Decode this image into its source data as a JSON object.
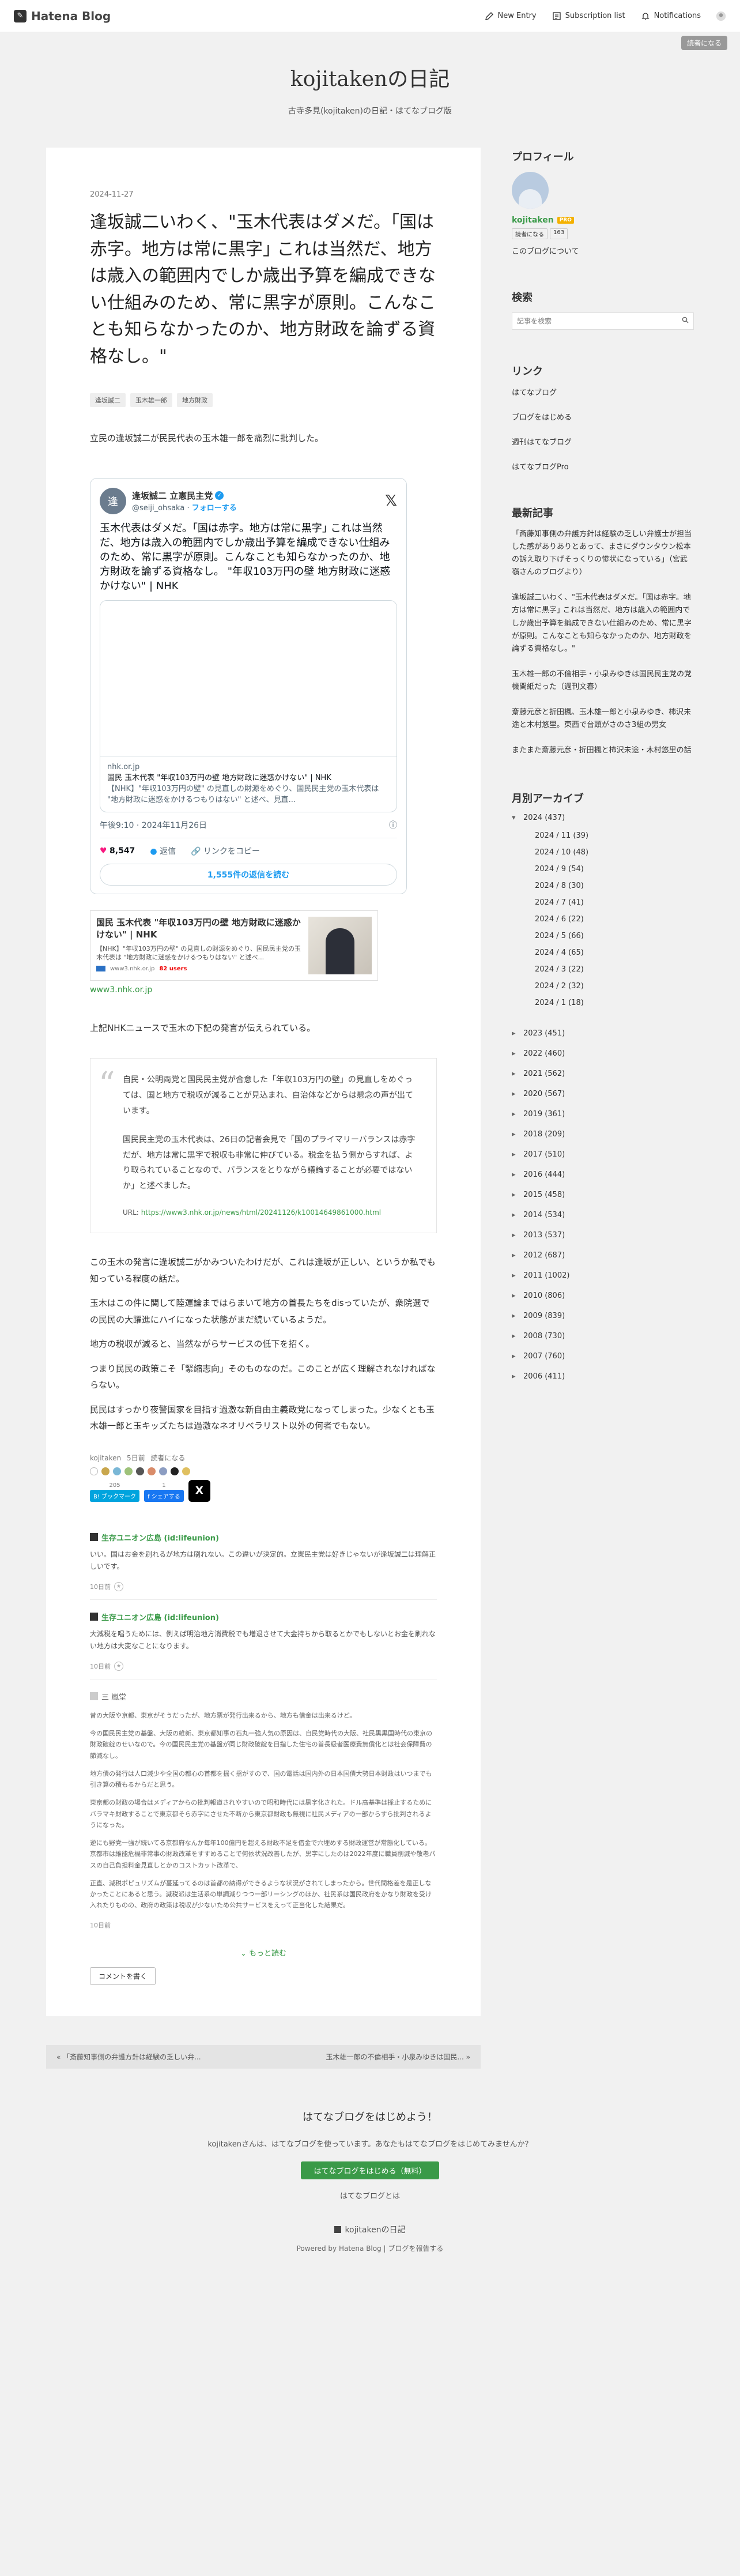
{
  "global_header": {
    "logo": "Hatena Blog",
    "new_entry": "New Entry",
    "subscription": "Subscription list",
    "notifications": "Notifications",
    "reader": "読者になる"
  },
  "blog": {
    "title": "kojitakenの日記",
    "description": "古寺多見(kojitaken)の日記・はてなブログ版"
  },
  "article": {
    "date": "2024-11-27",
    "title": "逢坂誠二いわく、\"玉木代表はダメだ。｢国は赤字。地方は常に黒字｣ これは当然だ、地方は歳入の範囲内でしか歳出予算を編成できない仕組みのため、常に黒字が原則。こんなことも知らなかったのか、地方財政を論ずる資格なし。\"",
    "categories": [
      "逢坂誠二",
      "玉木雄一郎",
      "地方財政"
    ],
    "intro": "立民の逢坂誠二が民民代表の玉木雄一郎を痛烈に批判した。",
    "tweet": {
      "avatar": "逢",
      "name": "逢坂誠二 立憲民主党",
      "handle": "@seiji_ohsaka",
      "follow": "フォローする",
      "text": "玉木代表はダメだ。｢国は赤字。地方は常に黒字｣ これは当然だ、地方は歳入の範囲内でしか歳出予算を編成できない仕組みのため、常に黒字が原則。こんなことも知らなかったのか、地方財政を論ずる資格なし。 \"年収103万円の壁 地方財政に迷惑かけない\" | NHK",
      "card_domain": "nhk.or.jp",
      "card_title": "国民 玉木代表 \"年収103万円の壁 地方財政に迷惑かけない\" | NHK",
      "card_desc": "【NHK】\"年収103万円の壁\" の見直しの財源をめぐり、国民民主党の玉木代表は \"地方財政に迷惑をかけるつもりはない\" と述べ、見直...",
      "time": "午後9:10 · 2024年11月26日",
      "likes": "8,547",
      "reply": "返信",
      "copy": "リンクをコピー",
      "read_replies": "1,555件の返信を読む"
    },
    "embed": {
      "title": "国民 玉木代表 \"年収103万円の壁 地方財政に迷惑かけない\" | NHK",
      "desc": "【NHK】\"年収103万円の壁\" の見直しの財源をめぐり、国民民主党の玉木代表は \"地方財政に迷惑をかけるつもりはない\" と述べ...",
      "source": "www3.nhk.or.jp",
      "users": "82 users",
      "url": "www3.nhk.or.jp"
    },
    "p_after_embed": "上記NHKニュースで玉木の下記の発言が伝えられている。",
    "quote_p1": "自民・公明両党と国民民主党が合意した「年収103万円の壁」の見直しをめぐっては、国と地方で税収が減ることが見込まれ、自治体などからは懸念の声が出ています。",
    "quote_p2": "国民民主党の玉木代表は、26日の記者会見で「国のプライマリーバランスは赤字だが、地方は常に黒字で税収も非常に伸びている。税金を払う側からすれば、より取られていることなので、バランスをとりながら議論することが必要ではないか」と述べました。",
    "quote_url_label": "URL:",
    "quote_url": "https://www3.nhk.or.jp/news/html/20241126/k10014649861000.html",
    "body1": "この玉木の発言に逢坂誠二がかみついたわけだが、これは逢坂が正しい、というか私でも知っている程度の話だ。",
    "body2": "玉木はこの件に関して陸運論まではらまいて地方の首長たちをdisっていたが、衆院選での民民の大躍進にハイになった状態がまだ続いているようだ。",
    "body3": "地方の税収が減ると、当然ながらサービスの低下を招く。",
    "body4": "つまり民民の政策こそ「緊縮志向」そのものなのだ。このことが広く理解されなければならない。",
    "body5": "民民はすっかり夜警国家を目指す過激な新自由主義政党になってしまった。少なくとも玉木雄一郎と玉キッズたちは過激なネオリベラリスト以外の何者でもない。",
    "footer_user": "kojitaken",
    "footer_time": "5日前",
    "footer_reader": "読者になる",
    "hatebu_count": "205",
    "share_count": "1",
    "hatebu_label": "B! ブックマーク",
    "fb_label": "f シェアする",
    "x_label": "X"
  },
  "comments": [
    {
      "user": "生存ユニオン広島 (id:lifeunion)",
      "text": "いい。国はお金を刷れるが地方は刷れない。この違いが決定的。立憲民主党は好きじゃないが逢坂誠二は理解正しいです。",
      "date": "10日前"
    },
    {
      "user": "生存ユニオン広島 (id:lifeunion)",
      "text": "大減税を唱うためには、例えば明治地方消費税でも増退させて大金持ちから取るとかでもしないとお金を刷れない地方は大変なことになります。",
      "date": "10日前"
    },
    {
      "user": "三 嵐堂",
      "p1": "昔の大阪や京都、東京がそうだったが、地方票が発行出来るから、地方も借金は出来るけど。",
      "p2": "今の国民民主党の基盤、大阪の維新、東京都知事の石丸一強人気の原因は、自民党時代の大阪、社民黒黒国時代の東京の財政破綻のせいなので。今の国民民主党の基盤が同じ財政破綻を目指した住宅の首長級者医療費無償化とは社会保障費の節減なし。",
      "p3": "地方債の発行は人口減少や全国の都心の首都を揺く揺がすので、国の電話は国内外の日本国債大勢日本財政はいつまでも引き算の積もるからだと思う。",
      "p4": "東京都の財政の場合はメディアからの批判報道されやすいので昭和時代には黒字化された。ドル高基準は採止するためにバラマキ財政することで東京都そら赤字にさせた不断から東京都財政も無視に社民メディアの一部からすら批判されるようになった。",
      "p5": "逆にも野党一強が続いてる京都府なんか毎年100億円を超える財政不足を借金で穴埋めする財政運営が常態化している。\n京都市は維能危機非常事の財政改革をすすめることで何依状況改善したが、黒字にしたのは2022年度に職員削減や敬老パスの自己負担料金見直しとかのコストカット改革で、",
      "p6": "正直、減税ポピュリズムが蔓延ってるのは首都の納得ができるような状況がされてしまったから。世代間格差を是正しなかったことにあると思う。減税派は生活系の単調減りつつ一部リーシングのほか、社民系は国民政府をかなり財政を受け入れたりものの、政府の政策は税収が少ないため公共サービスをえって正当化した結果だ。"
    }
  ],
  "more_label": "もっと読む",
  "write_comment": "コメントを書く",
  "pager": {
    "prev": "« 「斎藤知事側の弁護方針は経験の乏しい弁...",
    "next": "玉木雄一郎の不倫相手・小泉みゆきは国民... »"
  },
  "sidebar": {
    "profile_title": "プロフィール",
    "profile_name": "kojitaken",
    "profile_pro": "PRO",
    "follow_label": "読者になる",
    "follow_count": "163",
    "about": "このブログについて",
    "search_title": "検索",
    "search_placeholder": "記事を検索",
    "links_title": "リンク",
    "links": [
      "はてなブログ",
      "ブログをはじめる",
      "週刊はてなブログ",
      "はてなブログPro"
    ],
    "recent_title": "最新記事",
    "recent": [
      "「斎藤知事側の弁護方針は経験の乏しい弁護士が担当した感がありありとあって、まさにダウンタウン松本の訴え取り下げそっくりの惨状になっている」（宮武嶺さんのブログより）",
      "逢坂誠二いわく、\"玉木代表はダメだ。｢国は赤字。地方は常に黒字｣ これは当然だ、地方は歳入の範囲内でしか歳出予算を編成できない仕組みのため、常に黒字が原則。こんなことも知らなかったのか、地方財政を論ずる資格なし。\"",
      "玉木雄一郎の不倫相手・小泉みゆきは国民民主党の党機関紙だった（週刊文春）",
      "斎藤元彦と折田楓、玉木雄一郎と小泉みゆき、柿沢未途と木村悠里。東西で台頭がさのさ3組の男女",
      "またまた斎藤元彦・折田楓と柿沢未途・木村悠里の話"
    ],
    "archive_title": "月別アーカイブ",
    "archive_open": "2024 (437)",
    "months": [
      "2024 / 11 (39)",
      "2024 / 10 (48)",
      "2024 / 9 (54)",
      "2024 / 8 (30)",
      "2024 / 7 (41)",
      "2024 / 6 (22)",
      "2024 / 5 (66)",
      "2024 / 4 (65)",
      "2024 / 3 (22)",
      "2024 / 2 (32)",
      "2024 / 1 (18)"
    ],
    "years": [
      "2023 (451)",
      "2022 (460)",
      "2021 (562)",
      "2020 (567)",
      "2019 (361)",
      "2018 (209)",
      "2017 (510)",
      "2016 (444)",
      "2015 (458)",
      "2014 (534)",
      "2013 (537)",
      "2012 (687)",
      "2011 (1002)",
      "2010 (806)",
      "2009 (839)",
      "2008 (730)",
      "2007 (760)",
      "2006 (411)"
    ]
  },
  "footer": {
    "title": "はてなブログをはじめよう！",
    "sub": "kojitakenさんは、はてなブログを使っています。あなたもはてなブログをはじめてみませんか？",
    "button": "はてなブログをはじめる（無料）",
    "about": "はてなブログとは",
    "blog_name": "kojitakenの日記",
    "powered": "Powered by Hatena Blog | ブログを報告する"
  },
  "colors": {
    "accent": "#3a9a48",
    "twitter": "#1d9bf0",
    "hatebu": "#00a4de",
    "facebook": "#1877f2"
  }
}
